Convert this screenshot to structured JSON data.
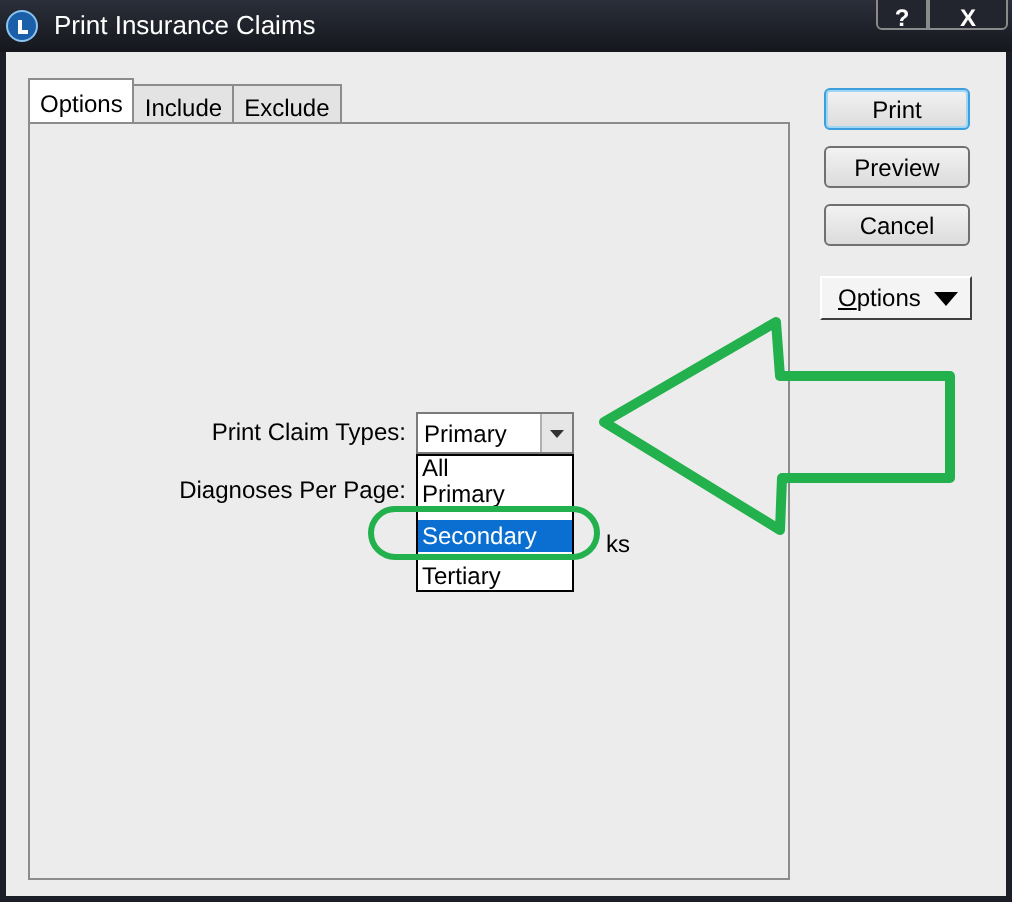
{
  "window": {
    "title": "Print Insurance Claims",
    "title_buttons": [
      "?",
      "X"
    ]
  },
  "tabs": [
    {
      "label": "Options",
      "selected": true
    },
    {
      "label": "Include",
      "selected": false
    },
    {
      "label": "Exclude",
      "selected": false
    }
  ],
  "form": {
    "claim_types_label": "Print Claim Types:",
    "claim_types_value": "Primary",
    "diagnoses_label": "Diagnoses Per Page:",
    "hidden_label_fragment": "ks"
  },
  "dropdown_list": [
    {
      "label": "All",
      "selected": false
    },
    {
      "label": "Primary",
      "selected": false
    },
    {
      "label": "Secondary",
      "selected": true
    },
    {
      "label": "Tertiary",
      "selected": false
    }
  ],
  "buttons": [
    {
      "label": "Print",
      "kind": "default"
    },
    {
      "label": "Preview",
      "kind": "plain"
    },
    {
      "label": "Cancel",
      "kind": "plain"
    },
    {
      "label": "Options",
      "kind": "menu"
    }
  ]
}
